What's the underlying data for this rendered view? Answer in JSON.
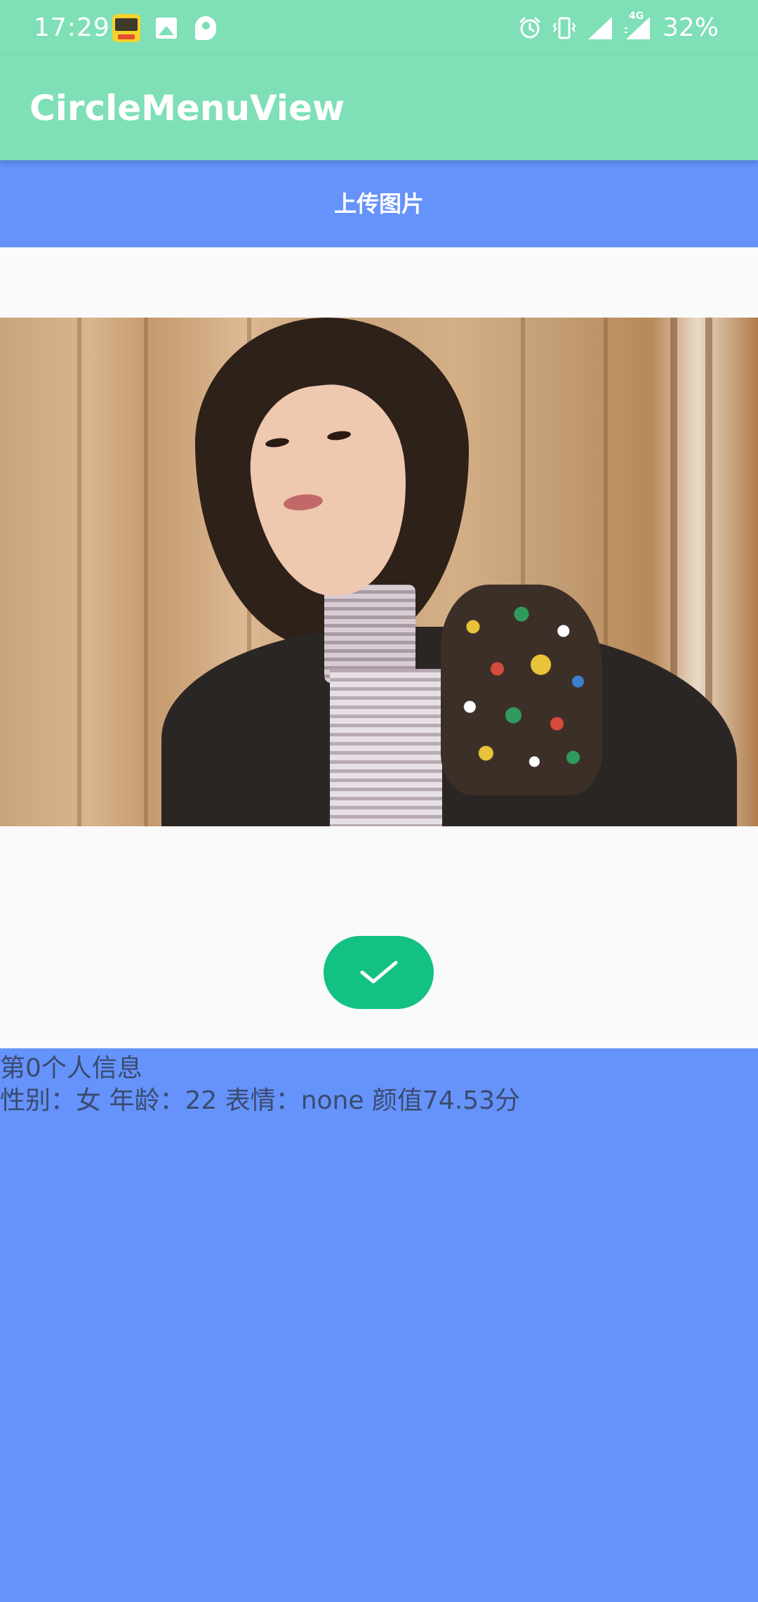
{
  "status_bar": {
    "time": "17:29",
    "battery": "32%",
    "network_label": "4G",
    "icons": [
      "news-app-icon",
      "image-icon",
      "parking-app-icon",
      "alarm-icon",
      "vibrate-icon",
      "signal-icon",
      "signal-4g-icon"
    ]
  },
  "app_bar": {
    "title": "CircleMenuView"
  },
  "upload": {
    "label": "上传图片"
  },
  "photo": {
    "alt": "uploaded portrait photo"
  },
  "confirm": {
    "icon": "checkmark-icon"
  },
  "result": {
    "heading": "第0个人信息",
    "details": "性别：女  年龄：22  表情：none  颜值74.53分"
  },
  "colors": {
    "status_bar": "#7fdfb7",
    "app_bar": "#7fdfb7",
    "upload_button": "#6593fb",
    "content_bg": "#fafafa",
    "confirm_button": "#13c183",
    "info_bg": "#6593fb",
    "info_text": "#3b4a6e"
  }
}
